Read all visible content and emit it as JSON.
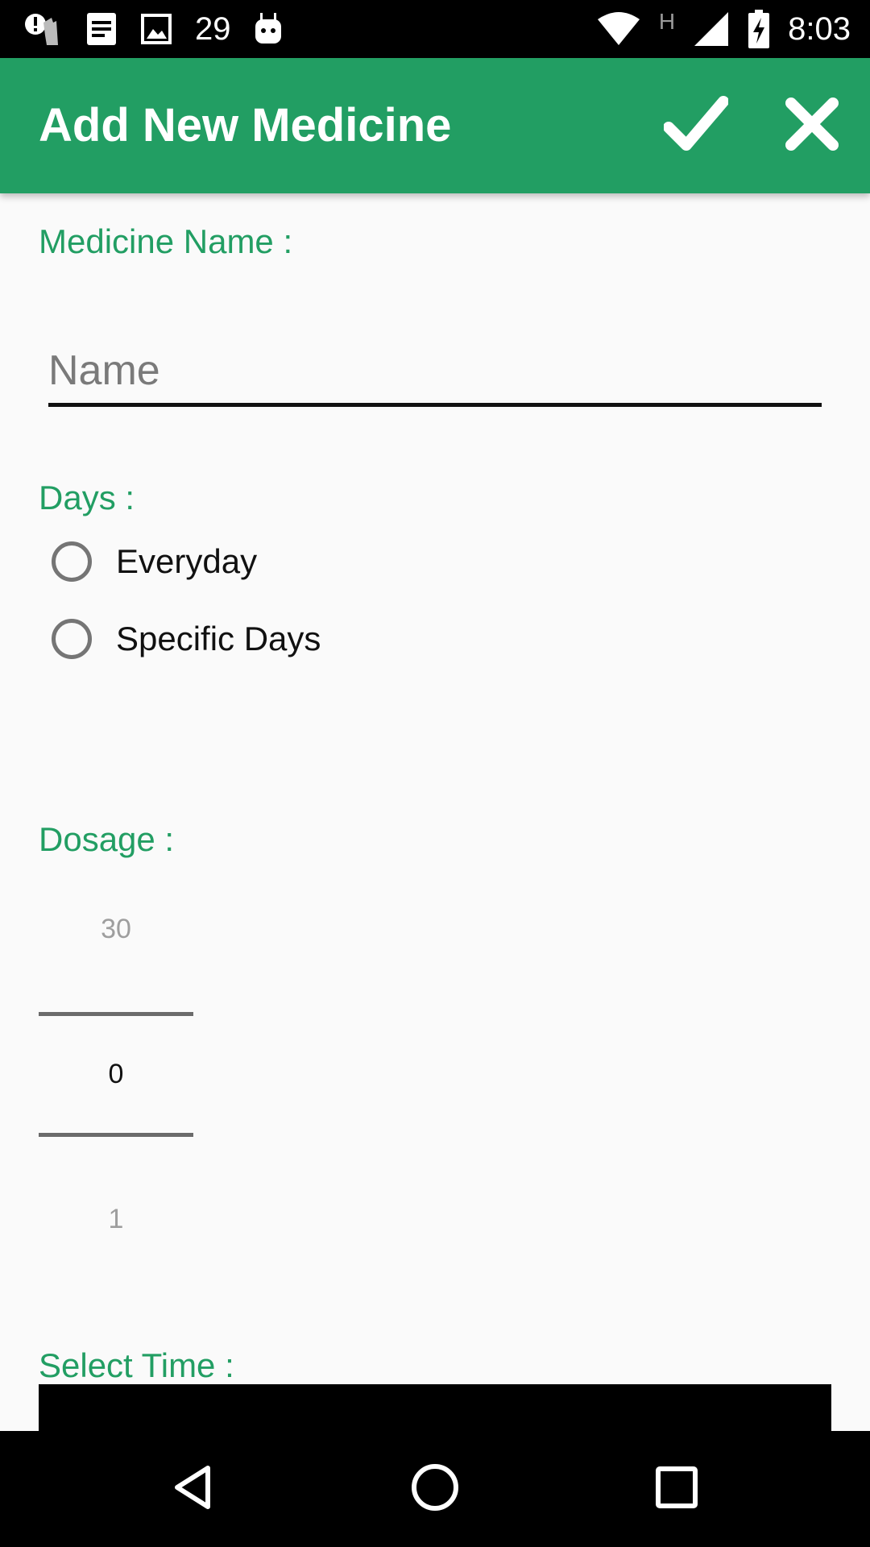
{
  "status_bar": {
    "notification_count": "29",
    "time": "8:03",
    "network_type": "H",
    "icons": [
      "alert-person-icon",
      "document-icon",
      "image-icon",
      "android-icon",
      "wifi-icon",
      "signal-icon",
      "battery-charging-icon"
    ]
  },
  "app_bar": {
    "title": "Add New Medicine",
    "confirm_icon": "check-icon",
    "close_icon": "close-icon",
    "color": "#229e63"
  },
  "form": {
    "medicine_name_label": "Medicine Name :",
    "name_placeholder": "Name",
    "name_value": "",
    "days_label": "Days :",
    "day_options": [
      "Everyday",
      "Specific Days"
    ],
    "dosage_label": "Dosage :",
    "dosage_picker": {
      "previous": "30",
      "selected": "0",
      "next": "1"
    },
    "select_time_label": "Select Time :"
  },
  "nav_bar": {
    "icons": [
      "back-icon",
      "home-icon",
      "recents-icon"
    ]
  }
}
